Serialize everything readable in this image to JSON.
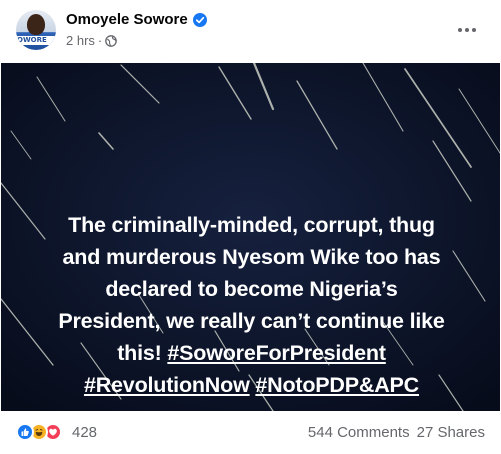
{
  "post": {
    "author": "Omoyele Sowore",
    "time": "2 hrs",
    "meta_dot": "·",
    "avatar_text": "OWORE",
    "text_lines": [
      "The criminally-minded, corrupt, thug",
      "and murderous Nyesom Wike too has",
      "declared to become Nigeria’s",
      "President, we really can’t continue like",
      "this!"
    ],
    "hashtags": [
      "#SoworeForPresident",
      "#RevolutionNow",
      "#NotoPDP&APC"
    ]
  },
  "footer": {
    "reaction_count": "428",
    "comments": "544 Comments",
    "shares": "27 Shares"
  },
  "icons": {
    "verified": "verified-badge-icon",
    "privacy": "globe-icon",
    "more": "more-options-icon",
    "reactions": [
      "like-icon",
      "haha-icon",
      "love-icon"
    ]
  },
  "colors": {
    "brand": "#1877f2",
    "image_background": "#0b1226",
    "secondary_text": "#65676b"
  }
}
